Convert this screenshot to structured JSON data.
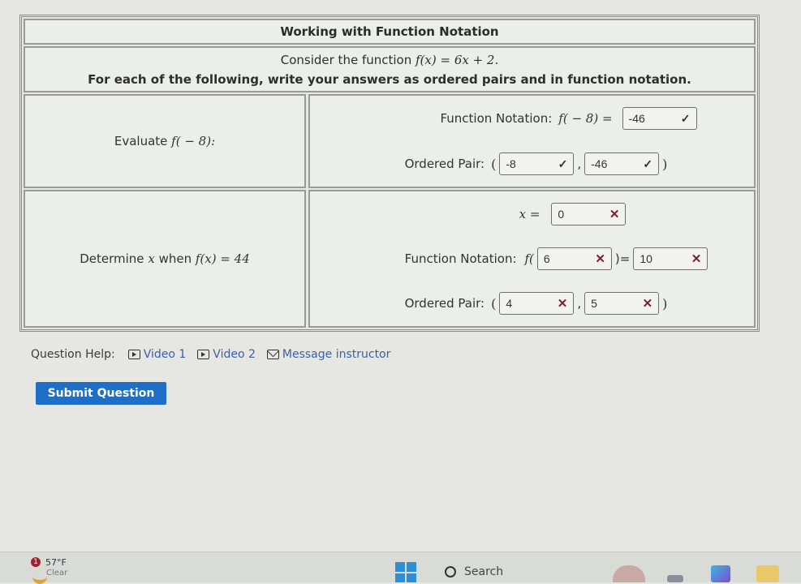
{
  "question": {
    "title": "Working with Function Notation",
    "intro_prefix": "Consider the function",
    "function_math": "f(x) = 6x + 2.",
    "instructions": "For each of the following, write your answers as ordered pairs and in function notation.",
    "part1": {
      "prompt_text": "Evaluate",
      "prompt_math": "f( − 8):",
      "function_notation_label": "Function Notation:",
      "function_notation_math": "f( − 8) =",
      "function_value": {
        "value": "-46",
        "status": "correct",
        "icon": "check-icon"
      },
      "ordered_pair_label": "Ordered Pair:",
      "pair_x": {
        "value": "-8",
        "status": "correct",
        "icon": "check-icon"
      },
      "pair_y": {
        "value": "-46",
        "status": "correct",
        "icon": "check-icon"
      },
      "comma": ",",
      "open_paren": "(",
      "close_paren": ")"
    },
    "part2": {
      "prompt_text": "Determine",
      "prompt_var": "x",
      "prompt_when": "when",
      "prompt_math": "f(x) = 44",
      "x_label_math": "x =",
      "x_value": {
        "value": "0",
        "status": "incorrect",
        "icon": "x-icon"
      },
      "function_notation_label": "Function Notation:",
      "f_open": "f(",
      "f_arg": {
        "value": "6",
        "status": "incorrect",
        "icon": "x-icon"
      },
      "f_close_eq": ")=",
      "f_value": {
        "value": "10",
        "status": "incorrect",
        "icon": "x-icon"
      },
      "ordered_pair_label": "Ordered Pair:",
      "pair_x": {
        "value": "4",
        "status": "incorrect",
        "icon": "x-icon"
      },
      "pair_y": {
        "value": "5",
        "status": "incorrect",
        "icon": "x-icon"
      },
      "comma": ",",
      "open_paren": "(",
      "close_paren": ")"
    }
  },
  "help": {
    "label": "Question Help:",
    "links": [
      {
        "label": "Video 1",
        "icon": "video-icon"
      },
      {
        "label": "Video 2",
        "icon": "video-icon"
      },
      {
        "label": "Message instructor",
        "icon": "mail-icon"
      }
    ]
  },
  "submit_label": "Submit Question",
  "symbols": {
    "check": "✓",
    "cross": "✕"
  },
  "colors": {
    "submit_bg": "#1f6fc9",
    "link": "#3f5ea8",
    "incorrect": "#7a1f2f"
  },
  "taskbar": {
    "weather_badge": "1",
    "temperature": "57°F",
    "condition": "Clear",
    "search_label": "Search"
  }
}
